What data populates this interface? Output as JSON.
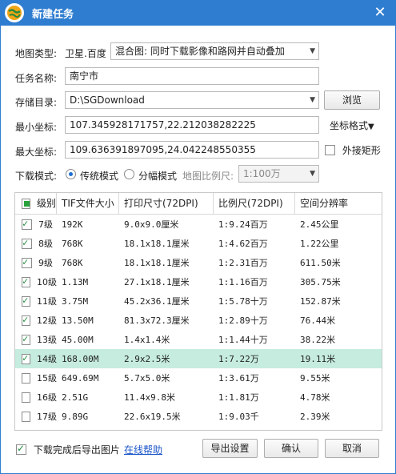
{
  "window": {
    "title": "新建任务",
    "close_glyph": "✕"
  },
  "form": {
    "map_type_label": "地图类型:",
    "map_type_value": "卫星.百度",
    "map_mode_value": "混合图: 同时下载影像和路网并自动叠加",
    "task_name_label": "任务名称:",
    "task_name_value": "南宁市",
    "storage_label": "存储目录:",
    "storage_value": "D:\\SGDownload",
    "browse_button": "浏览",
    "min_coord_label": "最小坐标:",
    "min_coord_value": "107.345928171757,22.212038282225",
    "coord_format_button": "坐标格式",
    "max_coord_label": "最大坐标:",
    "max_coord_value": "109.636391897095,24.042248550355",
    "outer_rect_label": "外接矩形",
    "download_mode_label": "下载模式:",
    "mode_traditional": "传统模式",
    "mode_tile": "分幅模式",
    "scale_label": "地图比例尺:",
    "scale_value": "1:100万"
  },
  "table": {
    "headers": [
      "级别",
      "TIF文件大小",
      "打印尺寸(72DPI)",
      "比例尺(72DPI)",
      "空间分辨率"
    ],
    "rows": [
      {
        "level": "7级",
        "size": "192K",
        "print": "9.0x9.0厘米",
        "scale": "1:9.24百万",
        "res": "2.45公里",
        "checked": true
      },
      {
        "level": "8级",
        "size": "768K",
        "print": "18.1x18.1厘米",
        "scale": "1:4.62百万",
        "res": "1.22公里",
        "checked": true
      },
      {
        "level": "9级",
        "size": "768K",
        "print": "18.1x18.1厘米",
        "scale": "1:2.31百万",
        "res": "611.50米",
        "checked": true
      },
      {
        "level": "10级",
        "size": "1.13M",
        "print": "27.1x18.1厘米",
        "scale": "1:1.16百万",
        "res": "305.75米",
        "checked": true
      },
      {
        "level": "11级",
        "size": "3.75M",
        "print": "45.2x36.1厘米",
        "scale": "1:5.78十万",
        "res": "152.87米",
        "checked": true
      },
      {
        "level": "12级",
        "size": "13.50M",
        "print": "81.3x72.3厘米",
        "scale": "1:2.89十万",
        "res": "76.44米",
        "checked": true
      },
      {
        "level": "13级",
        "size": "45.00M",
        "print": "1.4x1.4米",
        "scale": "1:1.44十万",
        "res": "38.22米",
        "checked": true
      },
      {
        "level": "14级",
        "size": "168.00M",
        "print": "2.9x2.5米",
        "scale": "1:7.22万",
        "res": "19.11米",
        "checked": true,
        "selected": true
      },
      {
        "level": "15级",
        "size": "649.69M",
        "print": "5.7x5.0米",
        "scale": "1:3.61万",
        "res": "9.55米",
        "checked": false
      },
      {
        "level": "16级",
        "size": "2.51G",
        "print": "11.4x9.8米",
        "scale": "1:1.81万",
        "res": "4.78米",
        "checked": false
      },
      {
        "level": "17级",
        "size": "9.89G",
        "print": "22.6x19.5米",
        "scale": "1:9.03千",
        "res": "2.39米",
        "checked": false
      }
    ]
  },
  "footer": {
    "export_after_label": "下载完成后导出图片",
    "help_link": "在线帮助",
    "export_settings_button": "导出设置",
    "confirm_button": "确认",
    "cancel_button": "取消"
  }
}
